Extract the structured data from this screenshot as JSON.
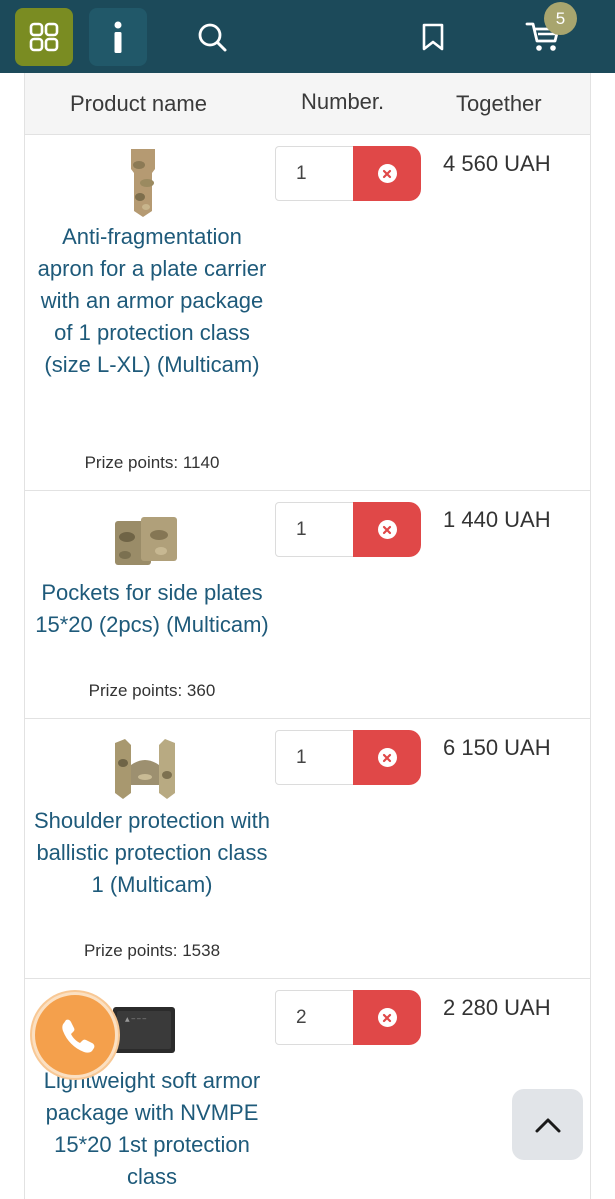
{
  "topbar": {
    "icons": [
      "grid-icon",
      "info-icon",
      "search-icon",
      "bookmark-icon",
      "cart-icon"
    ],
    "cart_count": "5",
    "colors": {
      "bar": "#1c4a5a",
      "grid_btn": "#7a8c22",
      "badge": "#a8a56e"
    }
  },
  "table": {
    "headers": {
      "name": "Product name",
      "number": "Number.",
      "together": "Together"
    },
    "rows": [
      {
        "name": "Anti-fragmentation apron for a plate carrier with an armor package of 1 protection class (size L-XL) (Multicam)",
        "points": "Prize points: 1140",
        "qty": "1",
        "total": "4 560 UAH"
      },
      {
        "name": "Pockets for side plates 15*20 (2pcs) (Multicam)",
        "points": "Prize points: 360",
        "qty": "1",
        "total": "1 440 UAH"
      },
      {
        "name": "Shoulder protection with ballistic protection class 1 (Multicam)",
        "points": "Prize points: 1538",
        "qty": "1",
        "total": "6 150 UAH"
      },
      {
        "name": "Lightweight soft armor package with NVMPE 15*20 1st protection class",
        "points": "",
        "qty": "2",
        "total": "2 280 UAH"
      }
    ]
  },
  "floating": {
    "phone_icon": "phone-icon",
    "scroll_icon": "chevron-up-icon",
    "phone_color": "#f4a04c"
  }
}
